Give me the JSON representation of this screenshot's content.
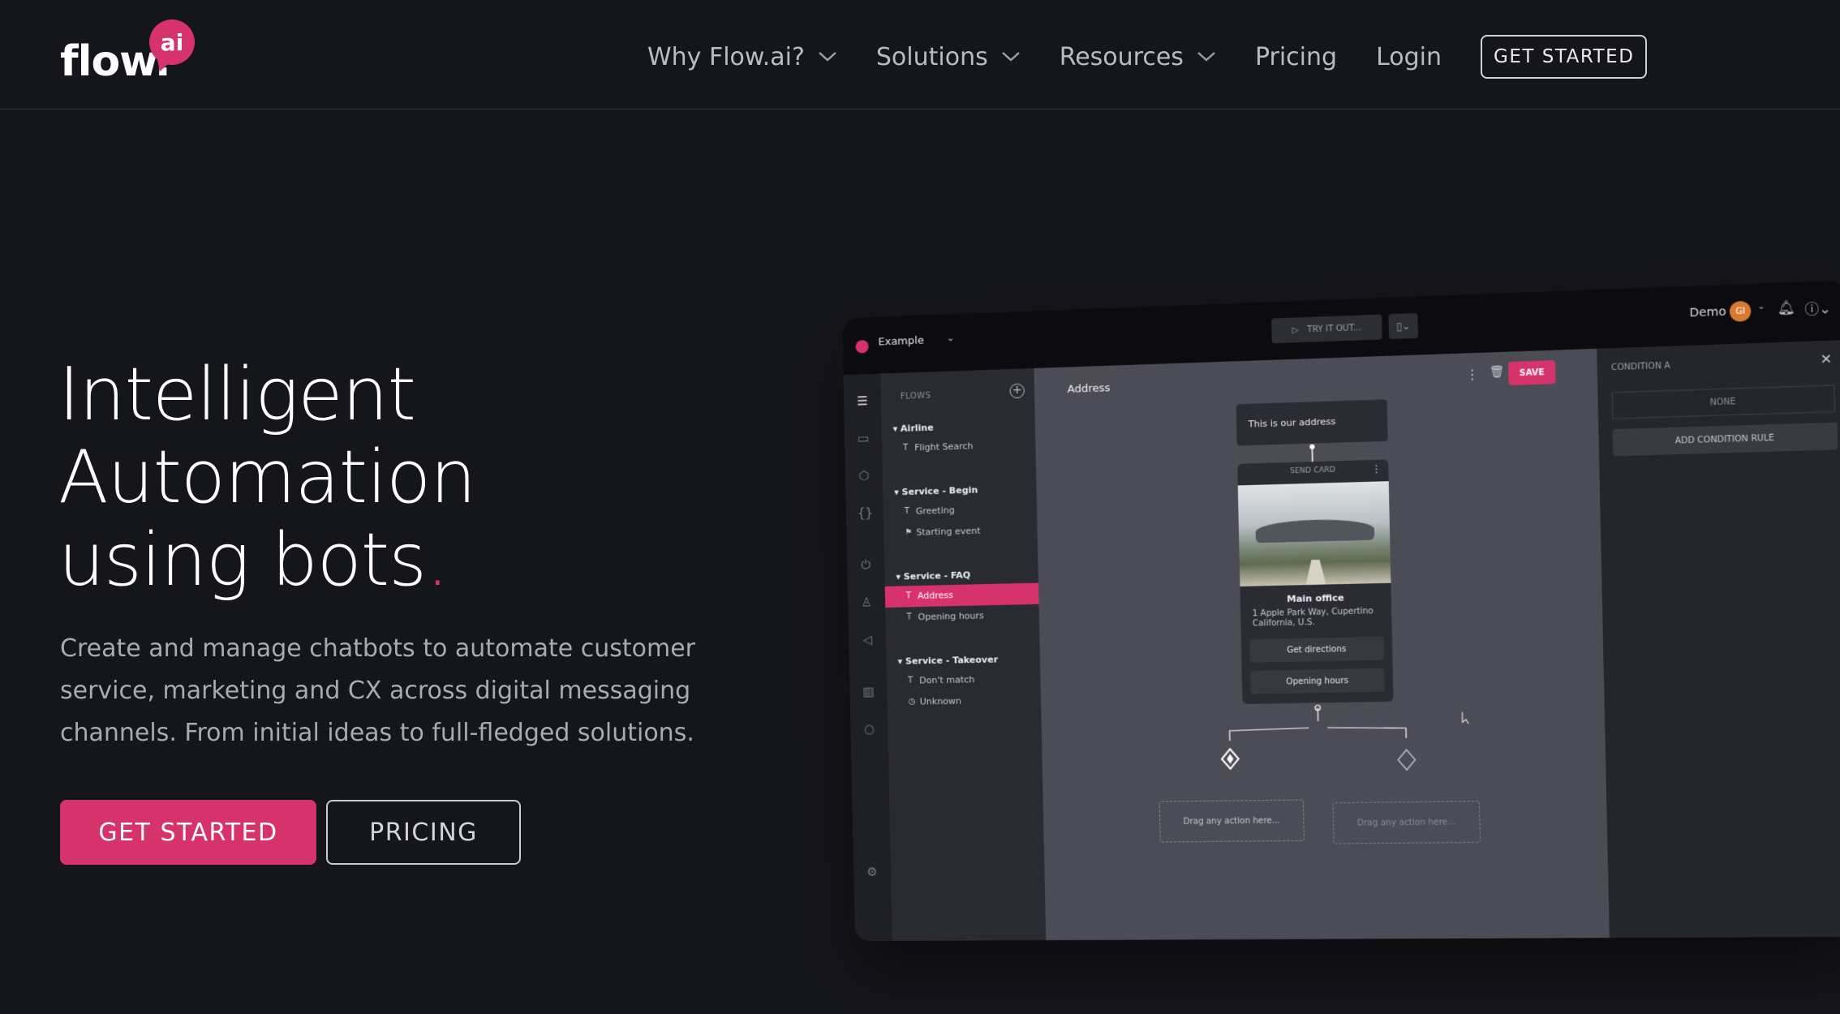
{
  "nav": {
    "logo_text": "flow.",
    "logo_badge": "ai",
    "links": [
      {
        "label": "Why Flow.ai?",
        "has_dropdown": true
      },
      {
        "label": "Solutions",
        "has_dropdown": true
      },
      {
        "label": "Resources",
        "has_dropdown": true
      },
      {
        "label": "Pricing",
        "has_dropdown": false
      },
      {
        "label": "Login",
        "has_dropdown": false
      }
    ],
    "cta": "GET STARTED"
  },
  "hero": {
    "title_line1": "Intelligent",
    "title_line2": "Automation",
    "title_line3": "using bots",
    "title_dot": ".",
    "subtitle": "Create and manage chatbots to automate customer service, marketing and CX across digital messaging channels. From initial ideas to full-fledged solutions.",
    "primary_button": "GET STARTED",
    "secondary_button": "PRICING"
  },
  "app": {
    "project": "Example",
    "try_label": "TRY IT OUT...",
    "user": "Demo",
    "avatar_initials": "GI",
    "flows_title": "FLOWS",
    "groups": [
      {
        "name": "Airline",
        "items": [
          {
            "label": "Flight Search",
            "glyph": "T"
          }
        ]
      },
      {
        "name": "Service - Begin",
        "items": [
          {
            "label": "Greeting",
            "glyph": "T"
          },
          {
            "label": "Starting event",
            "glyph": "⚑"
          }
        ]
      },
      {
        "name": "Service - FAQ",
        "items": [
          {
            "label": "Address",
            "glyph": "T",
            "active": true
          },
          {
            "label": "Opening hours",
            "glyph": "T"
          }
        ]
      },
      {
        "name": "Service - Takeover",
        "items": [
          {
            "label": "Don't match",
            "glyph": "T"
          },
          {
            "label": "Unknown",
            "glyph": "◷"
          }
        ]
      }
    ],
    "canvas_title": "Address",
    "save_label": "SAVE",
    "text_node": "This is our address",
    "card": {
      "header": "SEND CARD",
      "title": "Main office",
      "address": "1 Apple Park Way, Cupertino California, U.S.",
      "buttons": [
        "Get directions",
        "Opening hours"
      ]
    },
    "drop_placeholders": [
      "Drag any action here...",
      "Drag any action here..."
    ],
    "condition_title": "CONDITION A",
    "condition_value": "NONE",
    "add_rule": "ADD CONDITION RULE"
  },
  "colors": {
    "background": "#15151c",
    "accent": "#d6336c"
  }
}
